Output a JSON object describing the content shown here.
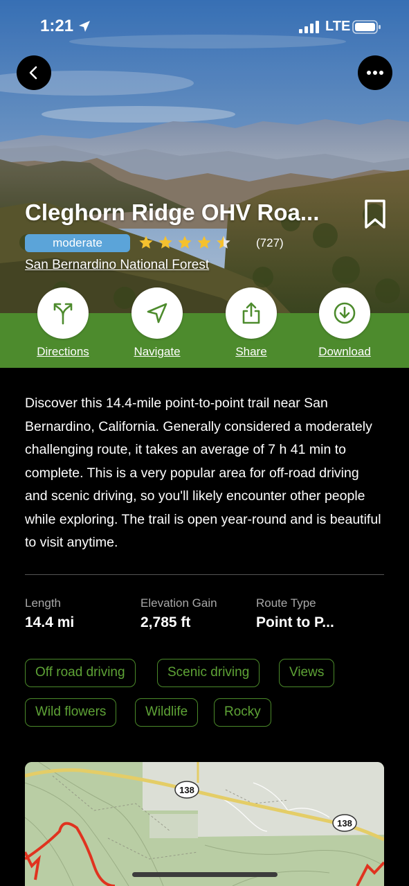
{
  "status_bar": {
    "time": "1:21",
    "network": "LTE"
  },
  "trail": {
    "title": "Cleghorn Ridge OHV Roa...",
    "difficulty": "moderate",
    "rating": 4.5,
    "review_count": "(727)",
    "park": "San Bernardino National Forest"
  },
  "actions": [
    {
      "label": "Directions",
      "icon": "directions-icon"
    },
    {
      "label": "Navigate",
      "icon": "navigate-icon"
    },
    {
      "label": "Share",
      "icon": "share-icon"
    },
    {
      "label": "Download",
      "icon": "download-icon"
    }
  ],
  "description": "Discover this 14.4-mile point-to-point trail near San Bernardino, California. Generally considered a moderately challenging route, it takes an average of 7 h 41 min to complete. This is a very popular area for off-road driving and scenic driving, so you'll likely encounter other people while exploring. The trail is open year-round and is beautiful to visit anytime.",
  "stats": [
    {
      "label": "Length",
      "value": "14.4 mi"
    },
    {
      "label": "Elevation Gain",
      "value": "2,785 ft"
    },
    {
      "label": "Route Type",
      "value": "Point to P..."
    }
  ],
  "tags": [
    "Off road driving",
    "Scenic driving",
    "Views",
    "Wild flowers",
    "Wildlife",
    "Rocky"
  ],
  "map": {
    "route_shields": [
      "138",
      "138"
    ]
  },
  "colors": {
    "accent_green": "#4d8b2d",
    "difficulty_blue": "#5ba4d9",
    "star_yellow": "#f5c12e"
  }
}
